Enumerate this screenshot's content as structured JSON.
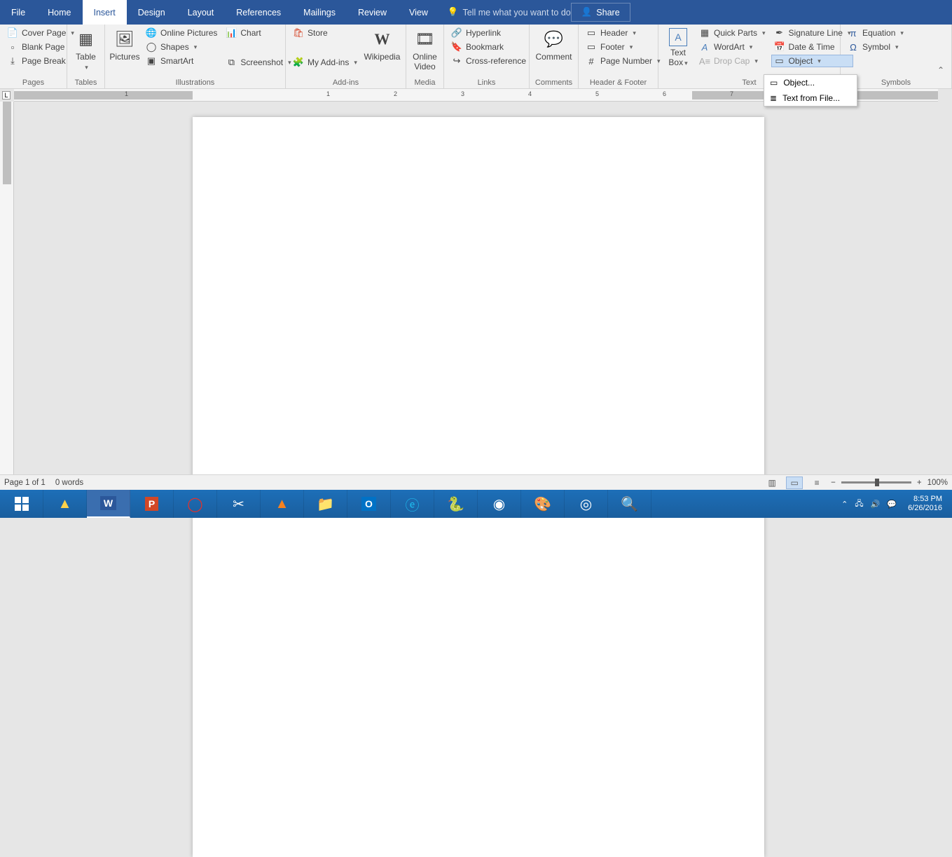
{
  "tabs": {
    "file": "File",
    "home": "Home",
    "insert": "Insert",
    "design": "Design",
    "layout": "Layout",
    "references": "References",
    "mailings": "Mailings",
    "review": "Review",
    "view": "View",
    "tell_me": "Tell me what you want to do",
    "share": "Share"
  },
  "ribbon": {
    "pages": {
      "label": "Pages",
      "cover_page": "Cover Page",
      "blank_page": "Blank Page",
      "page_break": "Page Break"
    },
    "tables": {
      "label": "Tables",
      "table": "Table"
    },
    "illustrations": {
      "label": "Illustrations",
      "pictures": "Pictures",
      "online_pictures": "Online Pictures",
      "shapes": "Shapes",
      "smartart": "SmartArt",
      "chart": "Chart",
      "screenshot": "Screenshot"
    },
    "addins": {
      "label": "Add-ins",
      "store": "Store",
      "my_addins": "My Add-ins",
      "wikipedia": "Wikipedia"
    },
    "media": {
      "label": "Media",
      "online_video": "Online\nVideo"
    },
    "links": {
      "label": "Links",
      "hyperlink": "Hyperlink",
      "bookmark": "Bookmark",
      "cross_reference": "Cross-reference"
    },
    "comments": {
      "label": "Comments",
      "comment": "Comment"
    },
    "header_footer": {
      "label": "Header & Footer",
      "header": "Header",
      "footer": "Footer",
      "page_number": "Page Number"
    },
    "text": {
      "label": "Text",
      "text_box": "Text\nBox",
      "quick_parts": "Quick Parts",
      "wordart": "WordArt",
      "drop_cap": "Drop Cap",
      "signature_line": "Signature Line",
      "date_time": "Date & Time",
      "object": "Object"
    },
    "symbols": {
      "label": "Symbols",
      "equation": "Equation",
      "symbol": "Symbol"
    }
  },
  "object_menu": {
    "object": "Object...",
    "text_from_file": "Text from File..."
  },
  "ruler": {
    "h_numbers": [
      "1",
      "1",
      "2",
      "3",
      "4",
      "5",
      "6",
      "7"
    ]
  },
  "status": {
    "page": "Page 1 of 1",
    "words": "0 words",
    "zoom": "100%"
  },
  "taskbar": {
    "time": "8:53 PM",
    "date": "6/26/2016"
  }
}
